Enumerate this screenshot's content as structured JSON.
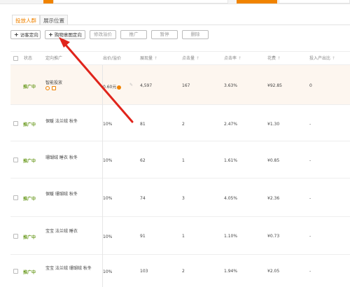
{
  "tabs": [
    {
      "label": "投放人群"
    },
    {
      "label": "展示位置"
    }
  ],
  "toolbar": {
    "add_targeting": "访客定向",
    "add_audience": "购物意图定向",
    "edit_bid": "修改溢价",
    "promote": "推广",
    "pause": "暂停",
    "delete": "删除"
  },
  "columns": {
    "status": "状态",
    "audience": "定向推广",
    "bid": "出价/溢价",
    "impressions": "展现量",
    "clicks": "点击量",
    "ctr": "点击率",
    "cost": "花费",
    "roi": "投入产出比",
    "sort_glyph": "↑"
  },
  "rows": [
    {
      "status": "推广中",
      "name": "智能投放",
      "bid": "0.60元",
      "impressions": "4,597",
      "clicks": "167",
      "ctr": "3.63%",
      "cost": "¥92.85",
      "roi": "0"
    },
    {
      "status": "推广中",
      "name": "保暖 法兰绒 秋冬",
      "bid": "10%",
      "impressions": "81",
      "clicks": "2",
      "ctr": "2.47%",
      "cost": "¥1.30",
      "roi": "-"
    },
    {
      "status": "推广中",
      "name": "珊瑚绒 睡衣 秋冬",
      "bid": "10%",
      "impressions": "62",
      "clicks": "1",
      "ctr": "1.61%",
      "cost": "¥0.85",
      "roi": "-"
    },
    {
      "status": "推广中",
      "name": "保暖 珊瑚绒 秋冬",
      "bid": "10%",
      "impressions": "74",
      "clicks": "3",
      "ctr": "4.05%",
      "cost": "¥2.36",
      "roi": "-"
    },
    {
      "status": "推广中",
      "name": "宝宝 法兰绒 睡衣",
      "bid": "10%",
      "impressions": "91",
      "clicks": "1",
      "ctr": "1.10%",
      "cost": "¥0.73",
      "roi": "-"
    },
    {
      "status": "推广中",
      "name": "宝宝 法兰绒 珊瑚绒 秋冬",
      "bid": "10%",
      "impressions": "103",
      "clicks": "2",
      "ctr": "1.94%",
      "cost": "¥2.05",
      "roi": "-"
    }
  ],
  "colors": {
    "accent": "#f08300",
    "status_green": "#6a9a1f",
    "arrow_red": "#e0241b"
  },
  "icons": {
    "bid_info": "info-icon",
    "edit": "pencil-icon",
    "smart_a": "target-icon",
    "smart_b": "calendar-icon",
    "add": "plus-icon"
  }
}
